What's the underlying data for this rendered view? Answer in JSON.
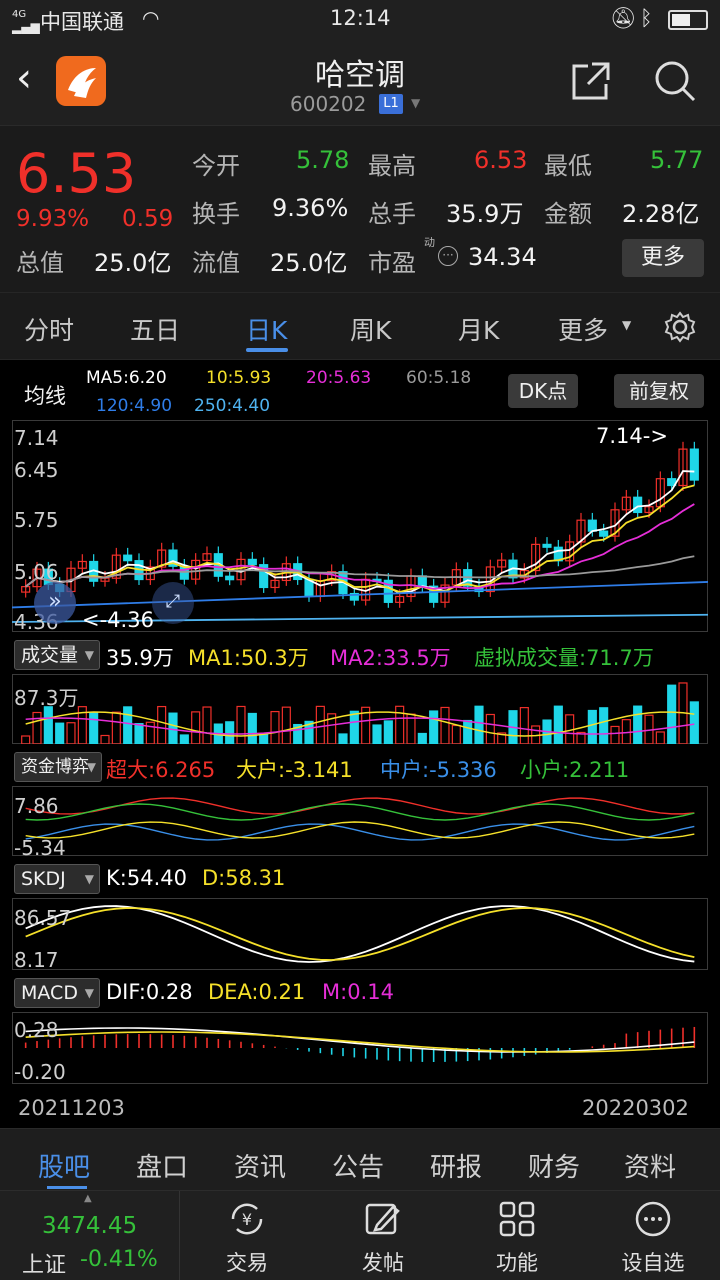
{
  "status_bar": {
    "network": "4G",
    "carrier": "中国联通",
    "time": "12:14"
  },
  "header": {
    "title": "哈空调",
    "code": "600202",
    "level": "L1"
  },
  "quote": {
    "price": "6.53",
    "change_pct": "9.93%",
    "change": "0.59",
    "open_label": "今开",
    "open": "5.78",
    "high_label": "最高",
    "high": "6.53",
    "low_label": "最低",
    "low": "5.77",
    "turnover_rate_label": "换手",
    "turnover_rate": "9.36%",
    "volume_label": "总手",
    "volume": "35.9万",
    "amount_label": "金额",
    "amount": "2.28亿",
    "mcap_label": "总值",
    "mcap": "25.0亿",
    "float_label": "流值",
    "float": "25.0亿",
    "pe_label": "市盈",
    "pe_sup": "动",
    "pe": "34.34",
    "more": "更多"
  },
  "tabs": [
    "分时",
    "五日",
    "日K",
    "周K",
    "月K",
    "更多"
  ],
  "active_tab": "日K",
  "ma_legend": {
    "title": "均线",
    "ma5": "MA5:6.20",
    "ma10": "10:5.93",
    "ma20": "20:5.63",
    "ma60": "60:5.18",
    "ma120": "120:4.90",
    "ma250": "250:4.40",
    "dk_button": "DK点",
    "fq_button": "前复权"
  },
  "kline": {
    "y_labels": [
      "7.14",
      "6.45",
      "5.75",
      "5.06",
      "4.36"
    ],
    "high_note": "7.14->",
    "low_note": "<-4.36"
  },
  "volume_panel": {
    "button": "成交量",
    "vol": "35.9万",
    "ma1": "MA1:50.3万",
    "ma2": "MA2:33.5万",
    "virtual": "虚拟成交量:71.7万",
    "y_label": "87.3万"
  },
  "fund_panel": {
    "button": "资金博弈",
    "super": "超大:6.265",
    "big": "大户:-3.141",
    "mid": "中户:-5.336",
    "small": "小户:2.211",
    "y_top": "7.86",
    "y_bottom": "-5.34"
  },
  "skdj_panel": {
    "button": "SKDJ",
    "k": "K:54.40",
    "d": "D:58.31",
    "y_top": "86.57",
    "y_bottom": "8.17"
  },
  "macd_panel": {
    "button": "MACD",
    "dif": "DIF:0.28",
    "dea": "DEA:0.21",
    "m": "M:0.14",
    "y_top": "0.28",
    "y_bottom": "-0.20"
  },
  "dates": {
    "start": "20211203",
    "end": "20220302"
  },
  "bottom_tabs": [
    "股吧",
    "盘口",
    "资讯",
    "公告",
    "研报",
    "财务",
    "资料"
  ],
  "bottom_bar": {
    "index_value": "3474.45",
    "index_name": "上证",
    "index_change": "-0.41%",
    "trade": "交易",
    "post": "发帖",
    "function": "功能",
    "watchlist": "设自选"
  },
  "chart_data": {
    "type": "candlestick",
    "x_range": [
      "20211203",
      "20220302"
    ],
    "y_range": [
      4.36,
      7.14
    ],
    "series": [
      {
        "name": "MA5",
        "value": 6.2
      },
      {
        "name": "10",
        "value": 5.93
      },
      {
        "name": "20",
        "value": 5.63
      },
      {
        "name": "60",
        "value": 5.18
      },
      {
        "name": "120",
        "value": 4.9
      },
      {
        "name": "250",
        "value": 4.4
      }
    ]
  },
  "colors": {
    "up": "#f0302a",
    "down": "#1fd6e8",
    "accent": "#4a8fe8",
    "ma5": "#ffffff",
    "ma10": "#f5e02a",
    "ma20": "#e62ed8",
    "ma60": "#9a9a9a",
    "ma120": "#2f7de8",
    "ma250": "#4fb3f0"
  }
}
